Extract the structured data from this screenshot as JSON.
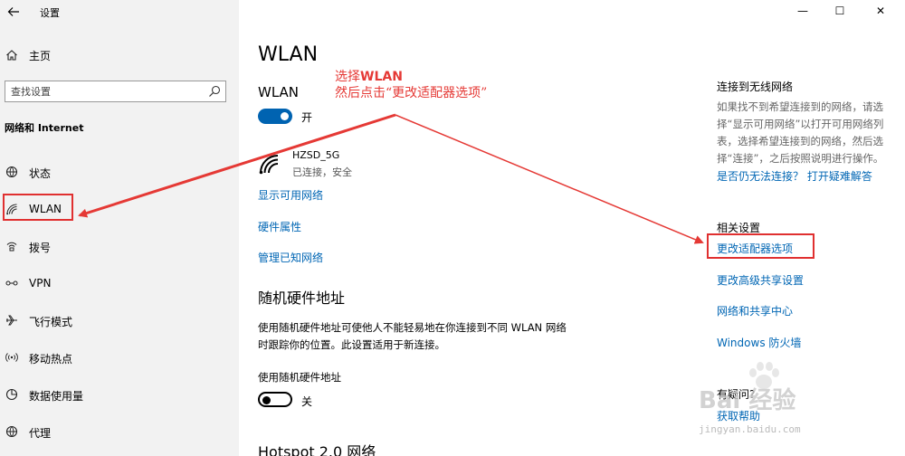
{
  "window": {
    "title": "设置",
    "controls": {
      "minimize": "—",
      "maximize": "☐",
      "close": "✕"
    }
  },
  "sidebar": {
    "home_label": "主页",
    "search": {
      "placeholder": "查找设置"
    },
    "section_title": "网络和 Internet",
    "items": [
      {
        "label": "状态",
        "icon": "globe-icon"
      },
      {
        "label": "WLAN",
        "icon": "wifi-icon"
      },
      {
        "label": "拨号",
        "icon": "phone-icon"
      },
      {
        "label": "VPN",
        "icon": "vpn-icon"
      },
      {
        "label": "飞行模式",
        "icon": "airplane-icon"
      },
      {
        "label": "移动热点",
        "icon": "hotspot-icon"
      },
      {
        "label": "数据使用量",
        "icon": "data-usage-icon"
      },
      {
        "label": "代理",
        "icon": "globe-icon"
      }
    ]
  },
  "main": {
    "page_title": "WLAN",
    "wlan_heading": "WLAN",
    "wlan_toggle": {
      "state": "on",
      "label": "开"
    },
    "network": {
      "name": "HZSD_5G",
      "status": "已连接，安全"
    },
    "links": [
      "显示可用网络",
      "硬件属性",
      "管理已知网络"
    ],
    "random_hw": {
      "heading": "随机硬件地址",
      "description_line1": "使用随机硬件地址可使他人不能轻易地在你连接到不同 WLAN 网络",
      "description_line2": "时跟踪你的位置。此设置适用于新连接。",
      "toggle_label_text": "使用随机硬件地址",
      "toggle": {
        "state": "off",
        "label": "关"
      }
    },
    "hotspot_heading": "Hotspot 2.0 网络"
  },
  "annotation": {
    "line1_prefix": "选择",
    "line1_bold": "WLAN",
    "line2": "然后点击“更改适配器选项”",
    "color": "#e53935"
  },
  "right_panel": {
    "wireless": {
      "title": "连接到无线网络",
      "line1": "如果找不到希望连接到的网络，请选",
      "line2": "择“显示可用网络”以打开可用网络列",
      "line3": "表，选择希望连接到的网络，然后选",
      "line4": "择“连接”，之后按照说明进行操作。",
      "help_link": "是否仍无法连接？ 打开疑难解答"
    },
    "related": {
      "title": "相关设置",
      "links": [
        "更改适配器选项",
        "更改高级共享设置",
        "网络和共享中心",
        "Windows 防火墙"
      ]
    },
    "questions": {
      "title": "有疑问?",
      "link": "获取帮助"
    }
  },
  "watermark": {
    "brand": "Bai 经验",
    "url": "jingyan.baidu.com"
  },
  "colors": {
    "accent": "#0063b1",
    "link": "#0066b4",
    "sidebar_bg": "#f2f2f2",
    "highlight": "#e03030"
  }
}
